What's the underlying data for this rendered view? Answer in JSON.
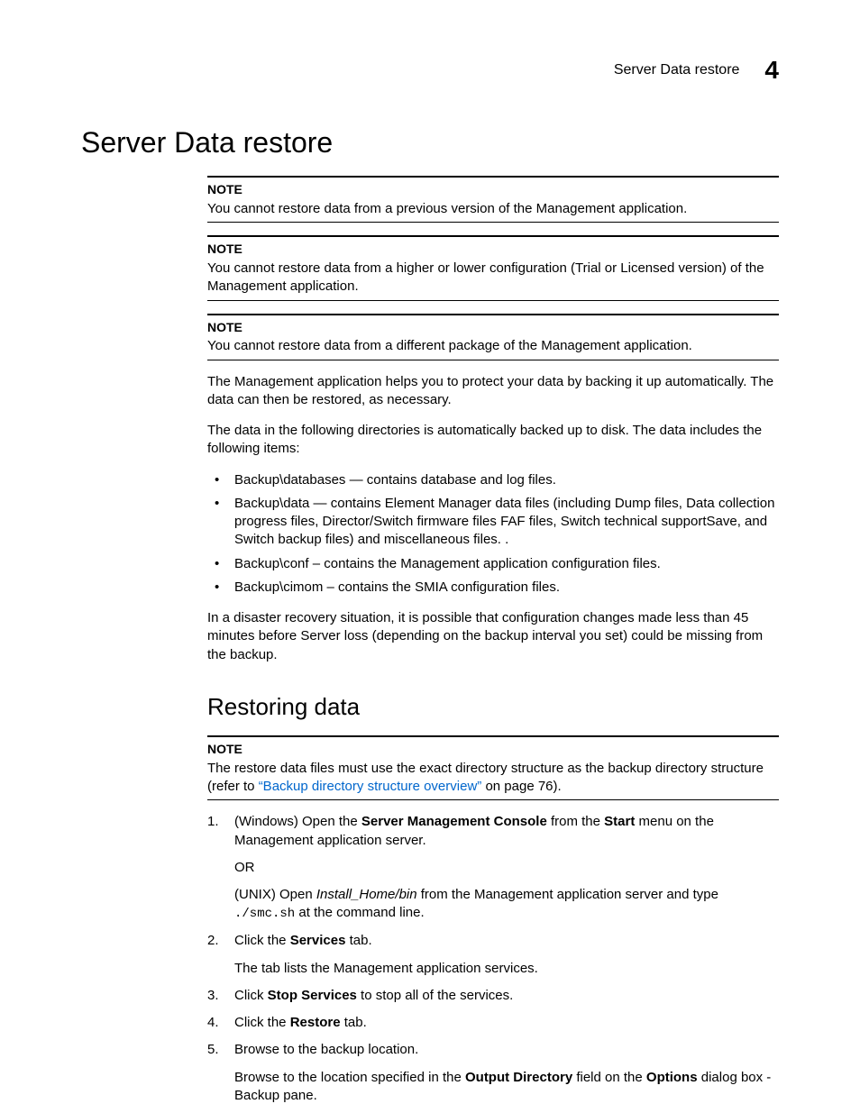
{
  "header": {
    "running_title": "Server Data restore",
    "chapter_number": "4"
  },
  "title": "Server Data restore",
  "notes": [
    {
      "label": "NOTE",
      "text": "You cannot restore data from a previous version of the Management application."
    },
    {
      "label": "NOTE",
      "text": "You cannot restore data from a higher or lower configuration (Trial or Licensed version) of the Management application."
    },
    {
      "label": "NOTE",
      "text": "You cannot restore data from a different package of the Management application."
    }
  ],
  "intro1": "The Management application helps you to protect your data by backing it up automatically. The data can then be restored, as necessary.",
  "intro2": "The data in the following directories is automatically backed up to disk. The data includes the following items:",
  "bullets": [
    "Backup\\databases — contains database and log files.",
    "Backup\\data — contains Element Manager data files (including Dump files, Data collection progress files, Director/Switch firmware files FAF files, Switch technical supportSave, and Switch backup files) and miscellaneous files. .",
    "Backup\\conf – contains the Management application configuration files.",
    "Backup\\cimom – contains the SMIA configuration files."
  ],
  "disaster": "In a disaster recovery situation, it is possible that configuration changes made less than 45 minutes before Server loss (depending on the backup interval you set) could be missing from the backup.",
  "sub_heading": "Restoring data",
  "note4": {
    "label": "NOTE",
    "pre": "The restore data files must use the exact directory structure as the backup directory structure (refer to ",
    "link": "“Backup directory structure overview”",
    "post": " on page 76)."
  },
  "steps": {
    "s1": {
      "win_pre": "(Windows) Open the ",
      "win_bold": "Server Management Console",
      "win_mid": " from the ",
      "win_bold2": "Start",
      "win_post": " menu on the Management application server.",
      "or": "OR",
      "unix_pre": "(UNIX) Open ",
      "unix_ital": "Install_Home/bin",
      "unix_mid": " from the Management application server and type ",
      "unix_mono": "./smc.sh",
      "unix_post": " at the command line."
    },
    "s2": {
      "pre": "Click the ",
      "bold": "Services",
      "post": " tab.",
      "sub": "The tab lists the Management application services."
    },
    "s3": {
      "pre": "Click ",
      "bold": "Stop Services",
      "post": " to stop all of the services."
    },
    "s4": {
      "pre": "Click the ",
      "bold": "Restore",
      "post": " tab."
    },
    "s5": {
      "main": "Browse to the backup location.",
      "sub_pre": "Browse to the location specified in the ",
      "sub_b1": "Output Directory",
      "sub_mid": " field on the ",
      "sub_b2": "Options",
      "sub_post": " dialog box - Backup pane."
    }
  }
}
